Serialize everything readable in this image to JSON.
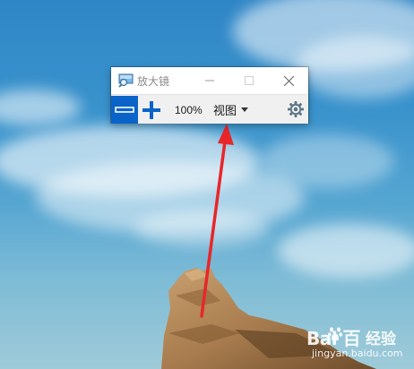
{
  "window": {
    "title": "放大镜",
    "controls": {
      "minimize": "minimize-icon",
      "maximize": "maximize-icon",
      "close": "close-icon"
    }
  },
  "toolbar": {
    "zoom_out": "minus-icon",
    "zoom_in": "plus-icon",
    "zoom_level": "100%",
    "view_label": "视图",
    "view_caret": "caret-down-icon",
    "settings": "gear-icon"
  },
  "watermark": {
    "brand": "Bai  百",
    "jingyan": "经验",
    "url": "jingyan.baidu.com"
  },
  "colors": {
    "accent": "#0a63c9",
    "arrow": "#e8262a",
    "sky_top": "#2f86c6",
    "sky_bottom": "#9fcbd8",
    "rock": "#b08659"
  }
}
